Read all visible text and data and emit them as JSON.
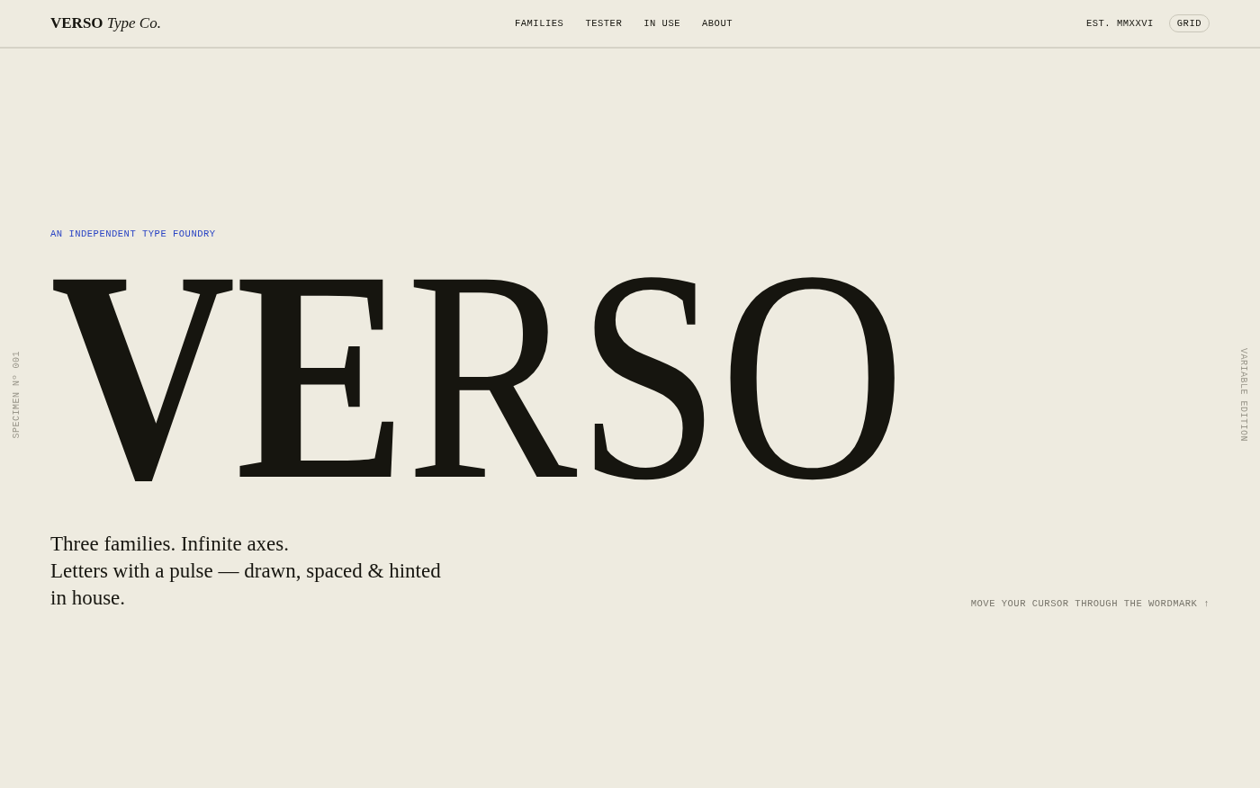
{
  "header": {
    "logo": "**VERSO** *Type Co.*",
    "nav": [
      {
        "label": "FAMILIES"
      },
      {
        "label": "TESTER"
      },
      {
        "label": "IN USE"
      },
      {
        "label": "ABOUT"
      }
    ],
    "established": "EST. MMXXVI",
    "grid_button": "GRID"
  },
  "side_labels": {
    "left": "SPECIMEN Nº 001",
    "right": "VARIABLE EDITION"
  },
  "hero": {
    "eyebrow": "AN INDEPENDENT TYPE FOUNDRY",
    "wordmark": "**VE**RSO",
    "description": "Three families. Infinite axes.\nLetters with a pulse — drawn, spaced & hinted in house.",
    "hint": "MOVE YOUR CURSOR THROUGH THE WORDMARK ↑"
  }
}
